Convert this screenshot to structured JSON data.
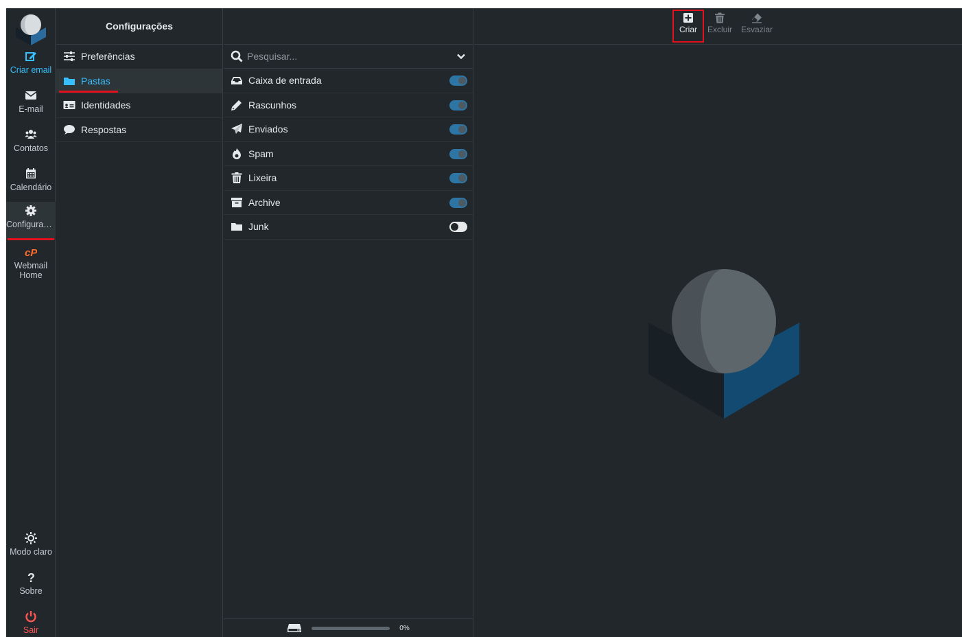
{
  "nav": {
    "compose": {
      "label": "Criar email",
      "icon": "compose-icon"
    },
    "mail": {
      "label": "E-mail",
      "icon": "envelope-icon"
    },
    "contacts": {
      "label": "Contatos",
      "icon": "users-icon"
    },
    "calendar": {
      "label": "Calendário",
      "icon": "calendar-icon"
    },
    "settings": {
      "label": "Configurações",
      "icon": "gear-icon"
    },
    "cpanel": {
      "label_line1": "Webmail",
      "label_line2": "Home",
      "icon": "cpanel-icon"
    },
    "theme": {
      "label": "Modo claro",
      "icon": "sun-icon"
    },
    "about": {
      "label": "Sobre",
      "icon": "question-icon"
    },
    "logout": {
      "label": "Sair",
      "icon": "power-icon"
    }
  },
  "sidebar": {
    "title": "Configurações",
    "items": [
      {
        "label": "Preferências",
        "icon": "sliders-icon"
      },
      {
        "label": "Pastas",
        "icon": "folder-icon"
      },
      {
        "label": "Identidades",
        "icon": "id-card-icon"
      },
      {
        "label": "Respostas",
        "icon": "comment-icon"
      }
    ]
  },
  "folders": {
    "search_placeholder": "Pesquisar...",
    "items": [
      {
        "label": "Caixa de entrada",
        "icon": "inbox-icon",
        "subscribed": true
      },
      {
        "label": "Rascunhos",
        "icon": "pencil-icon",
        "subscribed": true
      },
      {
        "label": "Enviados",
        "icon": "paper-plane-icon",
        "subscribed": true
      },
      {
        "label": "Spam",
        "icon": "fire-icon",
        "subscribed": true
      },
      {
        "label": "Lixeira",
        "icon": "trash-icon",
        "subscribed": true
      },
      {
        "label": "Archive",
        "icon": "archive-icon",
        "subscribed": true
      },
      {
        "label": "Junk",
        "icon": "folder-icon",
        "subscribed": false
      }
    ],
    "quota": {
      "text": "0%",
      "percent": 0
    }
  },
  "toolbar": {
    "create": "Criar",
    "delete": "Excluir",
    "purge": "Esvaziar"
  },
  "colors": {
    "accent": "#37beff",
    "highlight_red": "#e2111e",
    "background": "#21272b"
  }
}
